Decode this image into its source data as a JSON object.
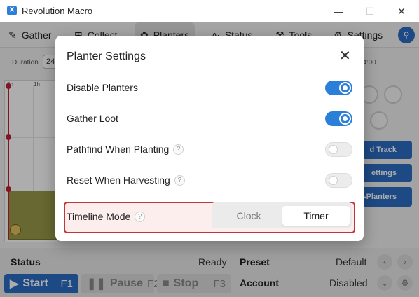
{
  "window": {
    "title": "Revolution Macro",
    "minimize": "—",
    "maximize": "☐",
    "close": "✕"
  },
  "tabs": [
    {
      "label": "Gather",
      "icon": "gather-icon"
    },
    {
      "label": "Collect",
      "icon": "collect-icon"
    },
    {
      "label": "Planters",
      "icon": "planters-icon",
      "active": true
    },
    {
      "label": "Status",
      "icon": "status-icon"
    },
    {
      "label": "Tools",
      "icon": "tools-icon"
    },
    {
      "label": "Settings",
      "icon": "settings-icon"
    }
  ],
  "planters_page": {
    "duration_label": "Duration",
    "duration_value": "24",
    "duration_right": "/24:00",
    "ticks": [
      "0h",
      "1h"
    ],
    "side_buttons": [
      "d Track",
      "ettings",
      "-Planters"
    ]
  },
  "status_bar": {
    "status_label": "Status",
    "status_value": "Ready",
    "preset_label": "Preset",
    "preset_value": "Default",
    "account_label": "Account",
    "account_value": "Disabled",
    "start_label": "Start",
    "start_key": "F1",
    "pause_label": "Pause",
    "pause_key": "F2",
    "stop_label": "Stop",
    "stop_key": "F3"
  },
  "modal": {
    "title": "Planter Settings",
    "close": "✕",
    "settings": [
      {
        "label": "Disable Planters",
        "enabled": true,
        "help": false
      },
      {
        "label": "Gather Loot",
        "enabled": true,
        "help": false
      },
      {
        "label": "Pathfind When Planting",
        "enabled": false,
        "help": true
      },
      {
        "label": "Reset When Harvesting",
        "enabled": false,
        "help": true
      }
    ],
    "timeline_mode": {
      "label": "Timeline Mode",
      "help": "?",
      "options": [
        "Clock",
        "Timer"
      ],
      "selected": "Timer"
    }
  },
  "colors": {
    "accent": "#2b7fd9",
    "highlight_border": "#c4343a",
    "highlight_bg": "#fdeeee"
  }
}
